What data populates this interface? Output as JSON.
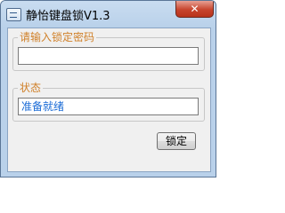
{
  "window": {
    "title": "静怡键盘锁V1.3",
    "icon": "keyboard-app-icon",
    "close_glyph": "✕"
  },
  "password_group": {
    "label": "请输入锁定密码",
    "input_value": "",
    "input_placeholder": ""
  },
  "status_group": {
    "label": "状态",
    "status_value": "准备就绪"
  },
  "buttons": {
    "lock_label": "锁定"
  },
  "colors": {
    "group_label": "#d0812a",
    "status_text": "#1a6bd6",
    "window_frame": "#b9d1ea",
    "close_button": "#c7442d"
  }
}
